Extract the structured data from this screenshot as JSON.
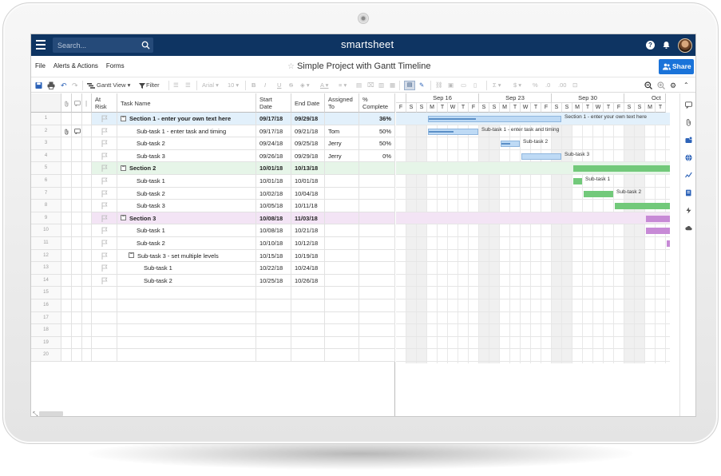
{
  "app": {
    "brand": "smartsheet",
    "search_placeholder": "Search...",
    "help_icon": "?",
    "doc_title": "Simple Project with Gantt Timeline",
    "share_label": "Share"
  },
  "menu": [
    "File",
    "Alerts & Actions",
    "Forms"
  ],
  "toolbar": {
    "gantt_view": "Gantt View",
    "filter": "Filter",
    "font": "Arial",
    "font_size": "10",
    "bold": "B",
    "italic": "I",
    "underline": "U",
    "strike": "S",
    "text_color": "A",
    "sum": "Σ",
    "currency": "$",
    "percent": "%"
  },
  "colors": {
    "navy": "#0e3462",
    "section1": "#e2f0fb",
    "section2": "#e6f5e8",
    "section3": "#f3e4f5",
    "blue_bar": "#bedaf5",
    "green_bar": "#72c97a",
    "purple_bar": "#c78ad6",
    "share_blue": "#1a73d9"
  },
  "columns": {
    "at_risk": [
      "At",
      "Risk"
    ],
    "task_name": "Task Name",
    "start": [
      "Start",
      "Date"
    ],
    "end": "End Date",
    "assigned": [
      "Assigned",
      "To"
    ],
    "complete": [
      "%",
      "Complete"
    ]
  },
  "rows": [
    {
      "num": "1",
      "task": "Section 1 - enter your own text here",
      "start": "09/17/18",
      "end": "09/29/18",
      "assigned": "",
      "pct": "36%",
      "level": 0,
      "section": 1
    },
    {
      "num": "2",
      "task": "Sub-task 1 - enter task and timing",
      "start": "09/17/18",
      "end": "09/21/18",
      "assigned": "Tom",
      "pct": "50%",
      "level": 1,
      "section": 0
    },
    {
      "num": "3",
      "task": "Sub-task 2",
      "start": "09/24/18",
      "end": "09/25/18",
      "assigned": "Jerry",
      "pct": "50%",
      "level": 1,
      "section": 0
    },
    {
      "num": "4",
      "task": "Sub-task 3",
      "start": "09/26/18",
      "end": "09/29/18",
      "assigned": "Jerry",
      "pct": "0%",
      "level": 1,
      "section": 0
    },
    {
      "num": "5",
      "task": "Section 2",
      "start": "10/01/18",
      "end": "10/13/18",
      "assigned": "",
      "pct": "",
      "level": 0,
      "section": 2
    },
    {
      "num": "6",
      "task": "Sub-task 1",
      "start": "10/01/18",
      "end": "10/01/18",
      "assigned": "",
      "pct": "",
      "level": 1,
      "section": 0
    },
    {
      "num": "7",
      "task": "Sub-task 2",
      "start": "10/02/18",
      "end": "10/04/18",
      "assigned": "",
      "pct": "",
      "level": 1,
      "section": 0
    },
    {
      "num": "8",
      "task": "Sub-task 3",
      "start": "10/05/18",
      "end": "10/11/18",
      "assigned": "",
      "pct": "",
      "level": 1,
      "section": 0
    },
    {
      "num": "9",
      "task": "Section 3",
      "start": "10/08/18",
      "end": "11/03/18",
      "assigned": "",
      "pct": "",
      "level": 0,
      "section": 3
    },
    {
      "num": "10",
      "task": "Sub-task 1",
      "start": "10/08/18",
      "end": "10/21/18",
      "assigned": "",
      "pct": "",
      "level": 1,
      "section": 0
    },
    {
      "num": "11",
      "task": "Sub-task 2",
      "start": "10/10/18",
      "end": "10/12/18",
      "assigned": "",
      "pct": "",
      "level": 1,
      "section": 0
    },
    {
      "num": "12",
      "task": "Sub-task 3 - set multiple levels",
      "start": "10/15/18",
      "end": "10/19/18",
      "assigned": "",
      "pct": "",
      "level": 1,
      "section": 0,
      "parent": true
    },
    {
      "num": "13",
      "task": "Sub-task 1",
      "start": "10/22/18",
      "end": "10/24/18",
      "assigned": "",
      "pct": "",
      "level": 2,
      "section": 0
    },
    {
      "num": "14",
      "task": "Sub-task 2",
      "start": "10/25/18",
      "end": "10/26/18",
      "assigned": "",
      "pct": "",
      "level": 2,
      "section": 0
    },
    {
      "num": "15",
      "task": "",
      "start": "",
      "end": "",
      "assigned": "",
      "pct": "",
      "level": 0,
      "section": 0,
      "empty": true
    },
    {
      "num": "16",
      "task": "",
      "start": "",
      "end": "",
      "assigned": "",
      "pct": "",
      "level": 0,
      "section": 0,
      "empty": true
    },
    {
      "num": "17",
      "task": "",
      "start": "",
      "end": "",
      "assigned": "",
      "pct": "",
      "level": 0,
      "section": 0,
      "empty": true
    },
    {
      "num": "18",
      "task": "",
      "start": "",
      "end": "",
      "assigned": "",
      "pct": "",
      "level": 0,
      "section": 0,
      "empty": true
    },
    {
      "num": "19",
      "task": "",
      "start": "",
      "end": "",
      "assigned": "",
      "pct": "",
      "level": 0,
      "section": 0,
      "empty": true
    },
    {
      "num": "20",
      "task": "",
      "start": "",
      "end": "",
      "assigned": "",
      "pct": "",
      "level": 0,
      "section": 0,
      "empty": true
    }
  ],
  "gantt": {
    "weeks": [
      "Sep 16",
      "Sep 23",
      "Sep 30",
      "Oct"
    ],
    "day_letters": [
      "F",
      "S",
      "S",
      "M",
      "T",
      "W",
      "T",
      "F",
      "S",
      "S",
      "M",
      "T",
      "W",
      "T",
      "F",
      "S",
      "S",
      "M",
      "T",
      "W",
      "T",
      "F",
      "S",
      "S",
      "M",
      "T"
    ],
    "bar_labels": {
      "1": "Section 1 - enter your own text here",
      "2": "Sub-task 1 - enter task and timing",
      "3": "Sub-task 2",
      "4": "Sub-task 3",
      "6": "Sub-task 1",
      "7": "Sub-task 2"
    }
  }
}
